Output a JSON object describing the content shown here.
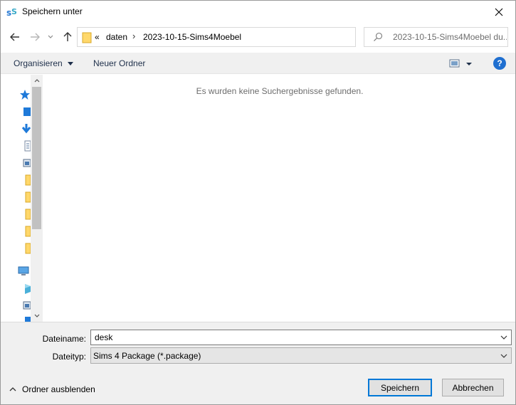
{
  "window": {
    "title": "Speichern unter",
    "icon": "sims4studio-app-icon"
  },
  "navigation": {
    "back": "arrow-left-icon",
    "forward": "arrow-right-icon",
    "recent": "chevron-down-icon",
    "up": "arrow-up-icon",
    "breadcrumb_overflow": "«",
    "breadcrumb": [
      "daten",
      "2023-10-15-Sims4Moebel"
    ],
    "refresh": "refresh-icon"
  },
  "search": {
    "placeholder": "2023-10-15-Sims4Moebel du..."
  },
  "toolbar": {
    "organize_label": "Organisieren",
    "new_folder_label": "Neuer Ordner",
    "help_label": "?"
  },
  "content": {
    "empty_message": "Es wurden keine Suchergebnisse gefunden."
  },
  "form": {
    "filename_label": "Dateiname:",
    "filename_value": "desk",
    "filetype_label": "Dateityp:",
    "filetype_value": "Sims 4 Package (*.package)"
  },
  "footer": {
    "hide_folders_label": "Ordner ausblenden",
    "save_label": "Speichern",
    "cancel_label": "Abbrechen"
  },
  "colors": {
    "accent": "#0078d7",
    "toolbar_bg": "#f0f0f0",
    "help_blue": "#1f6fd0"
  }
}
